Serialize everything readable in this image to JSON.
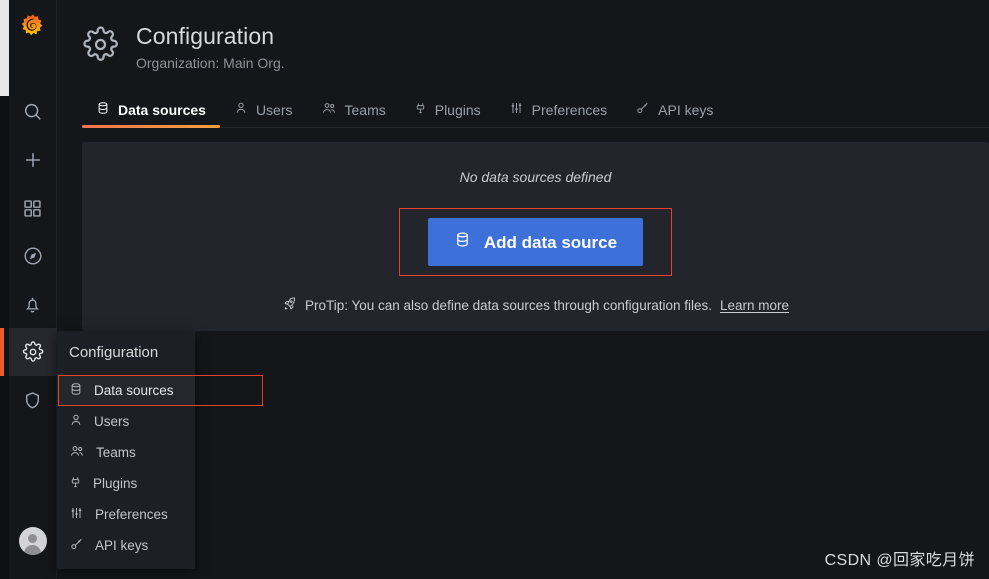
{
  "nav": {
    "logo_icon": "grafana-logo-icon",
    "items": [
      {
        "name": "search",
        "icon": "search-icon"
      },
      {
        "name": "create",
        "icon": "plus-icon"
      },
      {
        "name": "dashboards",
        "icon": "apps-grid-icon"
      },
      {
        "name": "explore",
        "icon": "compass-icon"
      },
      {
        "name": "alerting",
        "icon": "bell-icon"
      },
      {
        "name": "configuration",
        "icon": "gear-icon",
        "active": true
      },
      {
        "name": "server-admin",
        "icon": "shield-icon"
      }
    ],
    "avatar_icon": "user-avatar-icon"
  },
  "header": {
    "icon": "gear-icon",
    "title": "Configuration",
    "subtitle": "Organization: Main Org."
  },
  "tabs": [
    {
      "label": "Data sources",
      "icon": "database-icon",
      "active": true
    },
    {
      "label": "Users",
      "icon": "user-icon",
      "active": false
    },
    {
      "label": "Teams",
      "icon": "users-icon",
      "active": false
    },
    {
      "label": "Plugins",
      "icon": "plug-icon",
      "active": false
    },
    {
      "label": "Preferences",
      "icon": "sliders-icon",
      "active": false
    },
    {
      "label": "API keys",
      "icon": "key-icon",
      "active": false
    }
  ],
  "main": {
    "empty_state_text": "No data sources defined",
    "add_button_label": "Add data source",
    "add_button_icon": "database-icon",
    "protip_icon": "rocket-icon",
    "protip_text": "ProTip: You can also define data sources through configuration files.",
    "protip_link": "Learn more"
  },
  "flyout": {
    "title": "Configuration",
    "items": [
      {
        "label": "Data sources",
        "icon": "database-icon",
        "selected": true
      },
      {
        "label": "Users",
        "icon": "user-icon",
        "selected": false
      },
      {
        "label": "Teams",
        "icon": "users-icon",
        "selected": false
      },
      {
        "label": "Plugins",
        "icon": "plug-icon",
        "selected": false
      },
      {
        "label": "Preferences",
        "icon": "sliders-icon",
        "selected": false
      },
      {
        "label": "API keys",
        "icon": "key-icon",
        "selected": false
      }
    ]
  },
  "watermark": "CSDN @回家吃月饼",
  "colors": {
    "accent_orange": "#f05a28",
    "primary_blue": "#3d71d9",
    "annotation_red": "#e8402a",
    "bg_app": "#141619",
    "bg_panel": "#22252b",
    "bg_flyout": "#1c1f23"
  }
}
